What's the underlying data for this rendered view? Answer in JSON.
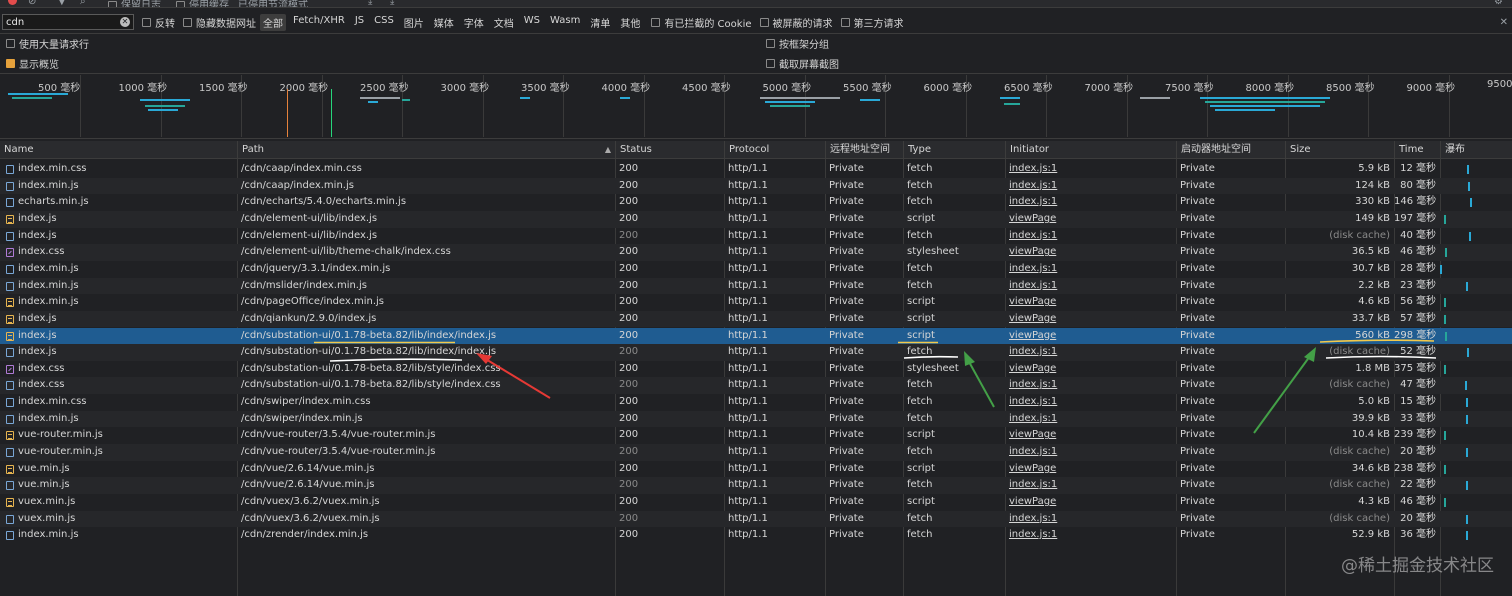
{
  "toolbar": {
    "preserve_log": "保留日志",
    "disable_cache": "停用缓存",
    "throttle": "已停用节流模式"
  },
  "filter": {
    "value": "cdn",
    "invert": "反转",
    "hide_data_urls": "隐藏数据网址",
    "types": [
      "全部",
      "Fetch/XHR",
      "JS",
      "CSS",
      "图片",
      "媒体",
      "字体",
      "文档",
      "WS",
      "Wasm",
      "清单",
      "其他"
    ],
    "active_type": "全部",
    "blocked_cookies": "有已拦截的 Cookie",
    "blocked_requests": "被屏蔽的请求",
    "third_party": "第三方请求"
  },
  "options": {
    "big_rows": "使用大量请求行",
    "group_by_frame": "按框架分组",
    "show_overview": "显示概览",
    "capture_screenshots": "截取屏幕截图"
  },
  "overview": {
    "ticks": [
      "500 毫秒",
      "1000 毫秒",
      "1500 毫秒",
      "2000 毫秒",
      "2500 毫秒",
      "3000 毫秒",
      "3500 毫秒",
      "4000 毫秒",
      "4500 毫秒",
      "5000 毫秒",
      "5500 毫秒",
      "6000 毫秒",
      "6500 毫秒",
      "7000 毫秒",
      "7500 毫秒",
      "8000 毫秒",
      "8500 毫秒",
      "9000 毫秒",
      "9500"
    ]
  },
  "table": {
    "headers": {
      "name": "Name",
      "path": "Path",
      "status": "Status",
      "protocol": "Protocol",
      "remote": "远程地址空间",
      "type": "Type",
      "initiator": "Initiator",
      "initiator_space": "启动器地址空间",
      "size": "Size",
      "time": "Time",
      "waterfall": "瀑布"
    },
    "rows": [
      {
        "name": "index.min.css",
        "path": "/cdn/caap/index.min.css",
        "status": "200",
        "protocol": "http/1.1",
        "remote": "Private",
        "type": "fetch",
        "initiator": "index.js:1",
        "space": "Private",
        "size": "5.9 kB",
        "time": "12 毫秒",
        "icon": "doc"
      },
      {
        "name": "index.min.js",
        "path": "/cdn/caap/index.min.js",
        "status": "200",
        "protocol": "http/1.1",
        "remote": "Private",
        "type": "fetch",
        "initiator": "index.js:1",
        "space": "Private",
        "size": "124 kB",
        "time": "80 毫秒",
        "icon": "doc"
      },
      {
        "name": "echarts.min.js",
        "path": "/cdn/echarts/5.4.0/echarts.min.js",
        "status": "200",
        "protocol": "http/1.1",
        "remote": "Private",
        "type": "fetch",
        "initiator": "index.js:1",
        "space": "Private",
        "size": "330 kB",
        "time": "146 毫秒",
        "icon": "doc"
      },
      {
        "name": "index.js",
        "path": "/cdn/element-ui/lib/index.js",
        "status": "200",
        "protocol": "http/1.1",
        "remote": "Private",
        "type": "script",
        "initiator": "viewPage",
        "space": "Private",
        "size": "149 kB",
        "time": "197 毫秒",
        "icon": "js"
      },
      {
        "name": "index.js",
        "path": "/cdn/element-ui/lib/index.js",
        "status": "200",
        "protocol": "http/1.1",
        "remote": "Private",
        "type": "fetch",
        "initiator": "index.js:1",
        "space": "Private",
        "size": "(disk cache)",
        "time": "40 毫秒",
        "icon": "doc"
      },
      {
        "name": "index.css",
        "path": "/cdn/element-ui/lib/theme-chalk/index.css",
        "status": "200",
        "protocol": "http/1.1",
        "remote": "Private",
        "type": "stylesheet",
        "initiator": "viewPage",
        "space": "Private",
        "size": "36.5 kB",
        "time": "46 毫秒",
        "icon": "css"
      },
      {
        "name": "index.min.js",
        "path": "/cdn/jquery/3.3.1/index.min.js",
        "status": "200",
        "protocol": "http/1.1",
        "remote": "Private",
        "type": "fetch",
        "initiator": "index.js:1",
        "space": "Private",
        "size": "30.7 kB",
        "time": "28 毫秒",
        "icon": "doc"
      },
      {
        "name": "index.min.js",
        "path": "/cdn/mslider/index.min.js",
        "status": "200",
        "protocol": "http/1.1",
        "remote": "Private",
        "type": "fetch",
        "initiator": "index.js:1",
        "space": "Private",
        "size": "2.2 kB",
        "time": "23 毫秒",
        "icon": "doc"
      },
      {
        "name": "index.min.js",
        "path": "/cdn/pageOffice/index.min.js",
        "status": "200",
        "protocol": "http/1.1",
        "remote": "Private",
        "type": "script",
        "initiator": "viewPage",
        "space": "Private",
        "size": "4.6 kB",
        "time": "56 毫秒",
        "icon": "js"
      },
      {
        "name": "index.js",
        "path": "/cdn/qiankun/2.9.0/index.js",
        "status": "200",
        "protocol": "http/1.1",
        "remote": "Private",
        "type": "script",
        "initiator": "viewPage",
        "space": "Private",
        "size": "33.7 kB",
        "time": "57 毫秒",
        "icon": "js"
      },
      {
        "name": "index.js",
        "path": "/cdn/substation-ui/0.1.78-beta.82/lib/index/index.js",
        "status": "200",
        "protocol": "http/1.1",
        "remote": "Private",
        "type": "script",
        "initiator": "viewPage",
        "space": "Private",
        "size": "560 kB",
        "time": "298 毫秒",
        "icon": "js"
      },
      {
        "name": "index.js",
        "path": "/cdn/substation-ui/0.1.78-beta.82/lib/index/index.js",
        "status": "200",
        "protocol": "http/1.1",
        "remote": "Private",
        "type": "fetch",
        "initiator": "index.js:1",
        "space": "Private",
        "size": "(disk cache)",
        "time": "52 毫秒",
        "icon": "doc"
      },
      {
        "name": "index.css",
        "path": "/cdn/substation-ui/0.1.78-beta.82/lib/style/index.css",
        "status": "200",
        "protocol": "http/1.1",
        "remote": "Private",
        "type": "stylesheet",
        "initiator": "viewPage",
        "space": "Private",
        "size": "1.8 MB",
        "time": "375 毫秒",
        "icon": "css"
      },
      {
        "name": "index.css",
        "path": "/cdn/substation-ui/0.1.78-beta.82/lib/style/index.css",
        "status": "200",
        "protocol": "http/1.1",
        "remote": "Private",
        "type": "fetch",
        "initiator": "index.js:1",
        "space": "Private",
        "size": "(disk cache)",
        "time": "47 毫秒",
        "icon": "doc"
      },
      {
        "name": "index.min.css",
        "path": "/cdn/swiper/index.min.css",
        "status": "200",
        "protocol": "http/1.1",
        "remote": "Private",
        "type": "fetch",
        "initiator": "index.js:1",
        "space": "Private",
        "size": "5.0 kB",
        "time": "15 毫秒",
        "icon": "doc"
      },
      {
        "name": "index.min.js",
        "path": "/cdn/swiper/index.min.js",
        "status": "200",
        "protocol": "http/1.1",
        "remote": "Private",
        "type": "fetch",
        "initiator": "index.js:1",
        "space": "Private",
        "size": "39.9 kB",
        "time": "33 毫秒",
        "icon": "doc"
      },
      {
        "name": "vue-router.min.js",
        "path": "/cdn/vue-router/3.5.4/vue-router.min.js",
        "status": "200",
        "protocol": "http/1.1",
        "remote": "Private",
        "type": "script",
        "initiator": "viewPage",
        "space": "Private",
        "size": "10.4 kB",
        "time": "239 毫秒",
        "icon": "js"
      },
      {
        "name": "vue-router.min.js",
        "path": "/cdn/vue-router/3.5.4/vue-router.min.js",
        "status": "200",
        "protocol": "http/1.1",
        "remote": "Private",
        "type": "fetch",
        "initiator": "index.js:1",
        "space": "Private",
        "size": "(disk cache)",
        "time": "20 毫秒",
        "icon": "doc"
      },
      {
        "name": "vue.min.js",
        "path": "/cdn/vue/2.6.14/vue.min.js",
        "status": "200",
        "protocol": "http/1.1",
        "remote": "Private",
        "type": "script",
        "initiator": "viewPage",
        "space": "Private",
        "size": "34.6 kB",
        "time": "238 毫秒",
        "icon": "js"
      },
      {
        "name": "vue.min.js",
        "path": "/cdn/vue/2.6.14/vue.min.js",
        "status": "200",
        "protocol": "http/1.1",
        "remote": "Private",
        "type": "fetch",
        "initiator": "index.js:1",
        "space": "Private",
        "size": "(disk cache)",
        "time": "22 毫秒",
        "icon": "doc"
      },
      {
        "name": "vuex.min.js",
        "path": "/cdn/vuex/3.6.2/vuex.min.js",
        "status": "200",
        "protocol": "http/1.1",
        "remote": "Private",
        "type": "script",
        "initiator": "viewPage",
        "space": "Private",
        "size": "4.3 kB",
        "time": "46 毫秒",
        "icon": "js"
      },
      {
        "name": "vuex.min.js",
        "path": "/cdn/vuex/3.6.2/vuex.min.js",
        "status": "200",
        "protocol": "http/1.1",
        "remote": "Private",
        "type": "fetch",
        "initiator": "index.js:1",
        "space": "Private",
        "size": "(disk cache)",
        "time": "20 毫秒",
        "icon": "doc"
      },
      {
        "name": "index.min.js",
        "path": "/cdn/zrender/index.min.js",
        "status": "200",
        "protocol": "http/1.1",
        "remote": "Private",
        "type": "fetch",
        "initiator": "index.js:1",
        "space": "Private",
        "size": "52.9 kB",
        "time": "36 毫秒",
        "icon": "doc"
      }
    ],
    "selected_index": 10
  },
  "annotations": {
    "red_arrow_color": "#e53935",
    "green_arrow_color": "#43a047",
    "yellow_underline_color": "#f2c94c"
  },
  "watermark": "@稀土掘金技术社区"
}
